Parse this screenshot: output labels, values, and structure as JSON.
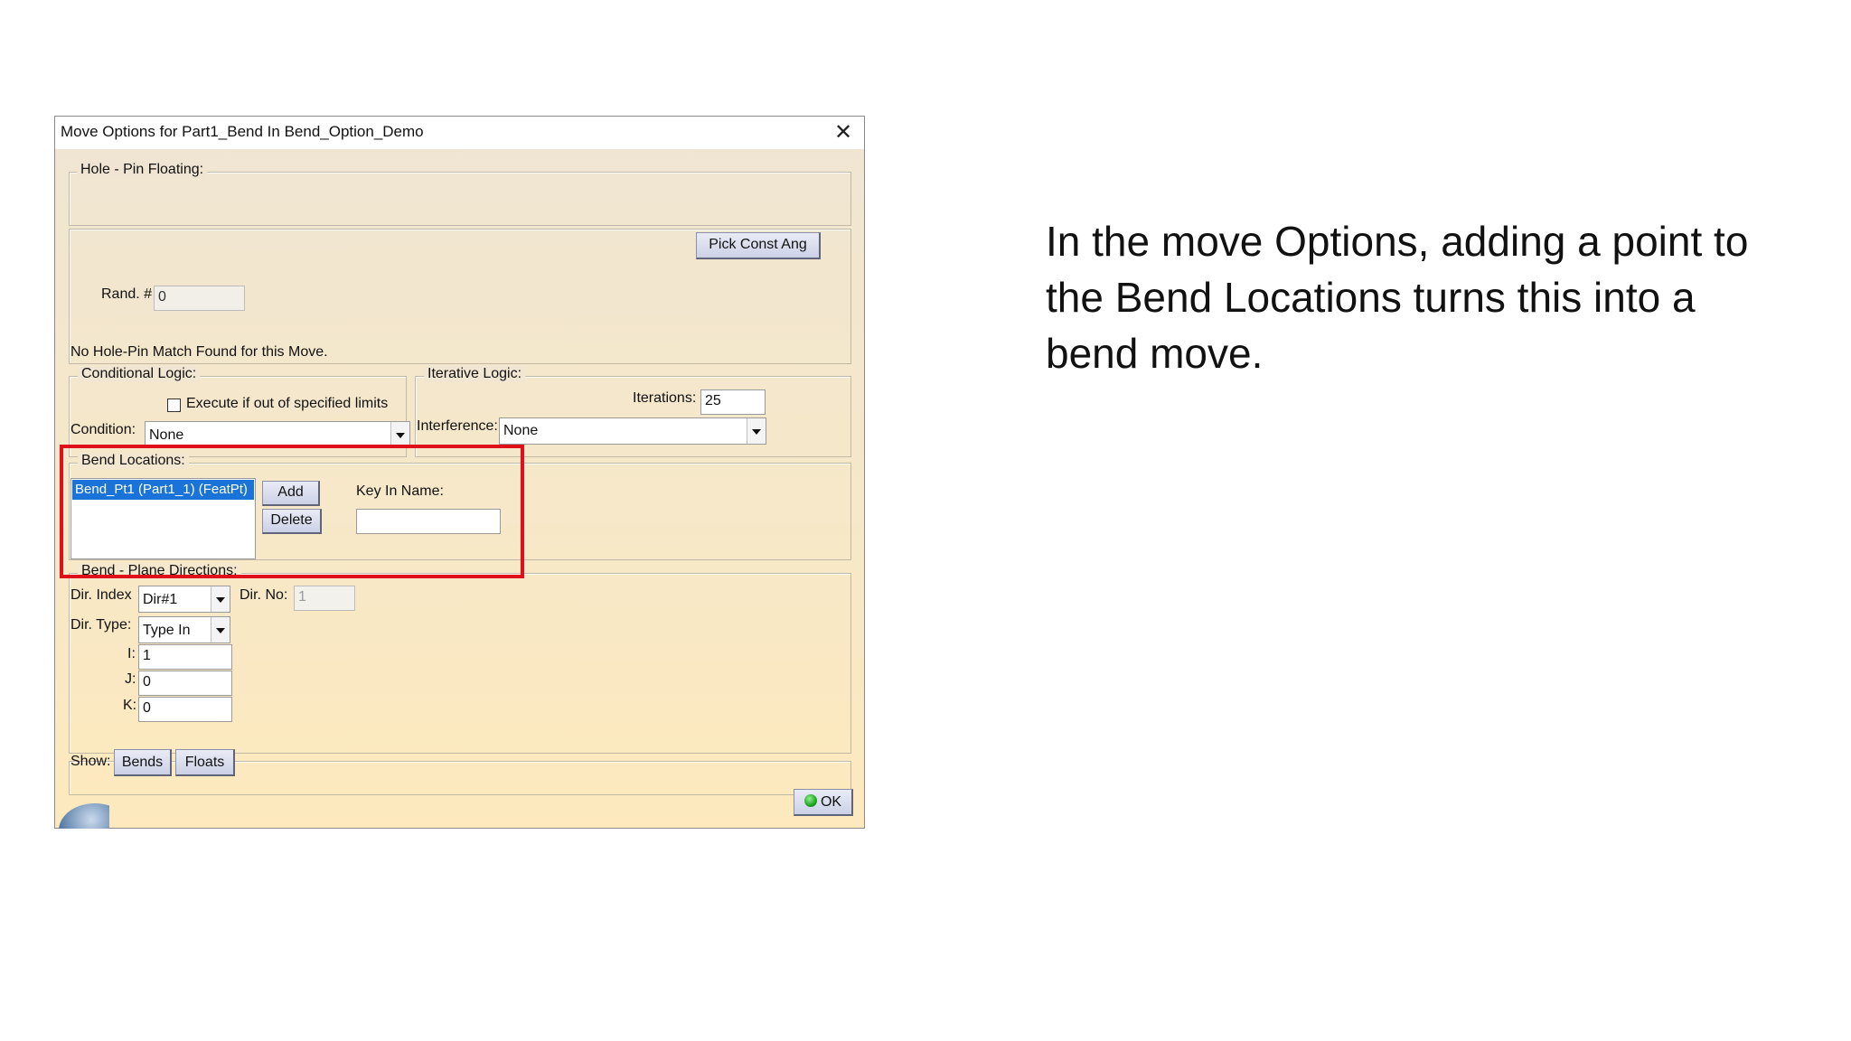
{
  "dialog": {
    "title": "Move Options for Part1_Bend In Bend_Option_Demo",
    "hole_pin": {
      "label": "Hole - Pin Floating:",
      "pick_const_ang": "Pick Const Ang",
      "rand_label": "Rand. #",
      "rand_value": "0",
      "status": "No Hole-Pin Match Found for this Move."
    },
    "conditional": {
      "label": "Conditional Logic:",
      "execute_label": "Execute if out of specified limits",
      "execute_checked": false,
      "condition_label": "Condition:",
      "condition_value": "None"
    },
    "iterative": {
      "label": "Iterative Logic:",
      "iterations_label": "Iterations:",
      "iterations_value": "25",
      "interference_label": "Interference:",
      "interference_value": "None"
    },
    "bend_locations": {
      "label": "Bend Locations:",
      "items": [
        "Bend_Pt1 (Part1_1) (FeatPt)"
      ],
      "add": "Add",
      "delete": "Delete",
      "key_in_label": "Key In Name:",
      "key_in_value": ""
    },
    "bend_plane": {
      "label": "Bend - Plane Directions:",
      "dir_index_label": "Dir. Index",
      "dir_index_value": "Dir#1",
      "dir_no_label": "Dir. No:",
      "dir_no_value": "1",
      "dir_type_label": "Dir. Type:",
      "dir_type_value": "Type In",
      "i_label": "I:",
      "i_value": "1",
      "j_label": "J:",
      "j_value": "0",
      "k_label": "K:",
      "k_value": "0"
    },
    "show": {
      "label": "Show:",
      "bends": "Bends",
      "floats": "Floats"
    },
    "ok": "OK"
  },
  "caption": "In the move Options, adding a point to the Bend Locations turns this into a bend move.",
  "colors": {
    "highlight_box": "#e0101a",
    "selection": "#1a73d9",
    "ok_icon": "#1fa51f"
  }
}
